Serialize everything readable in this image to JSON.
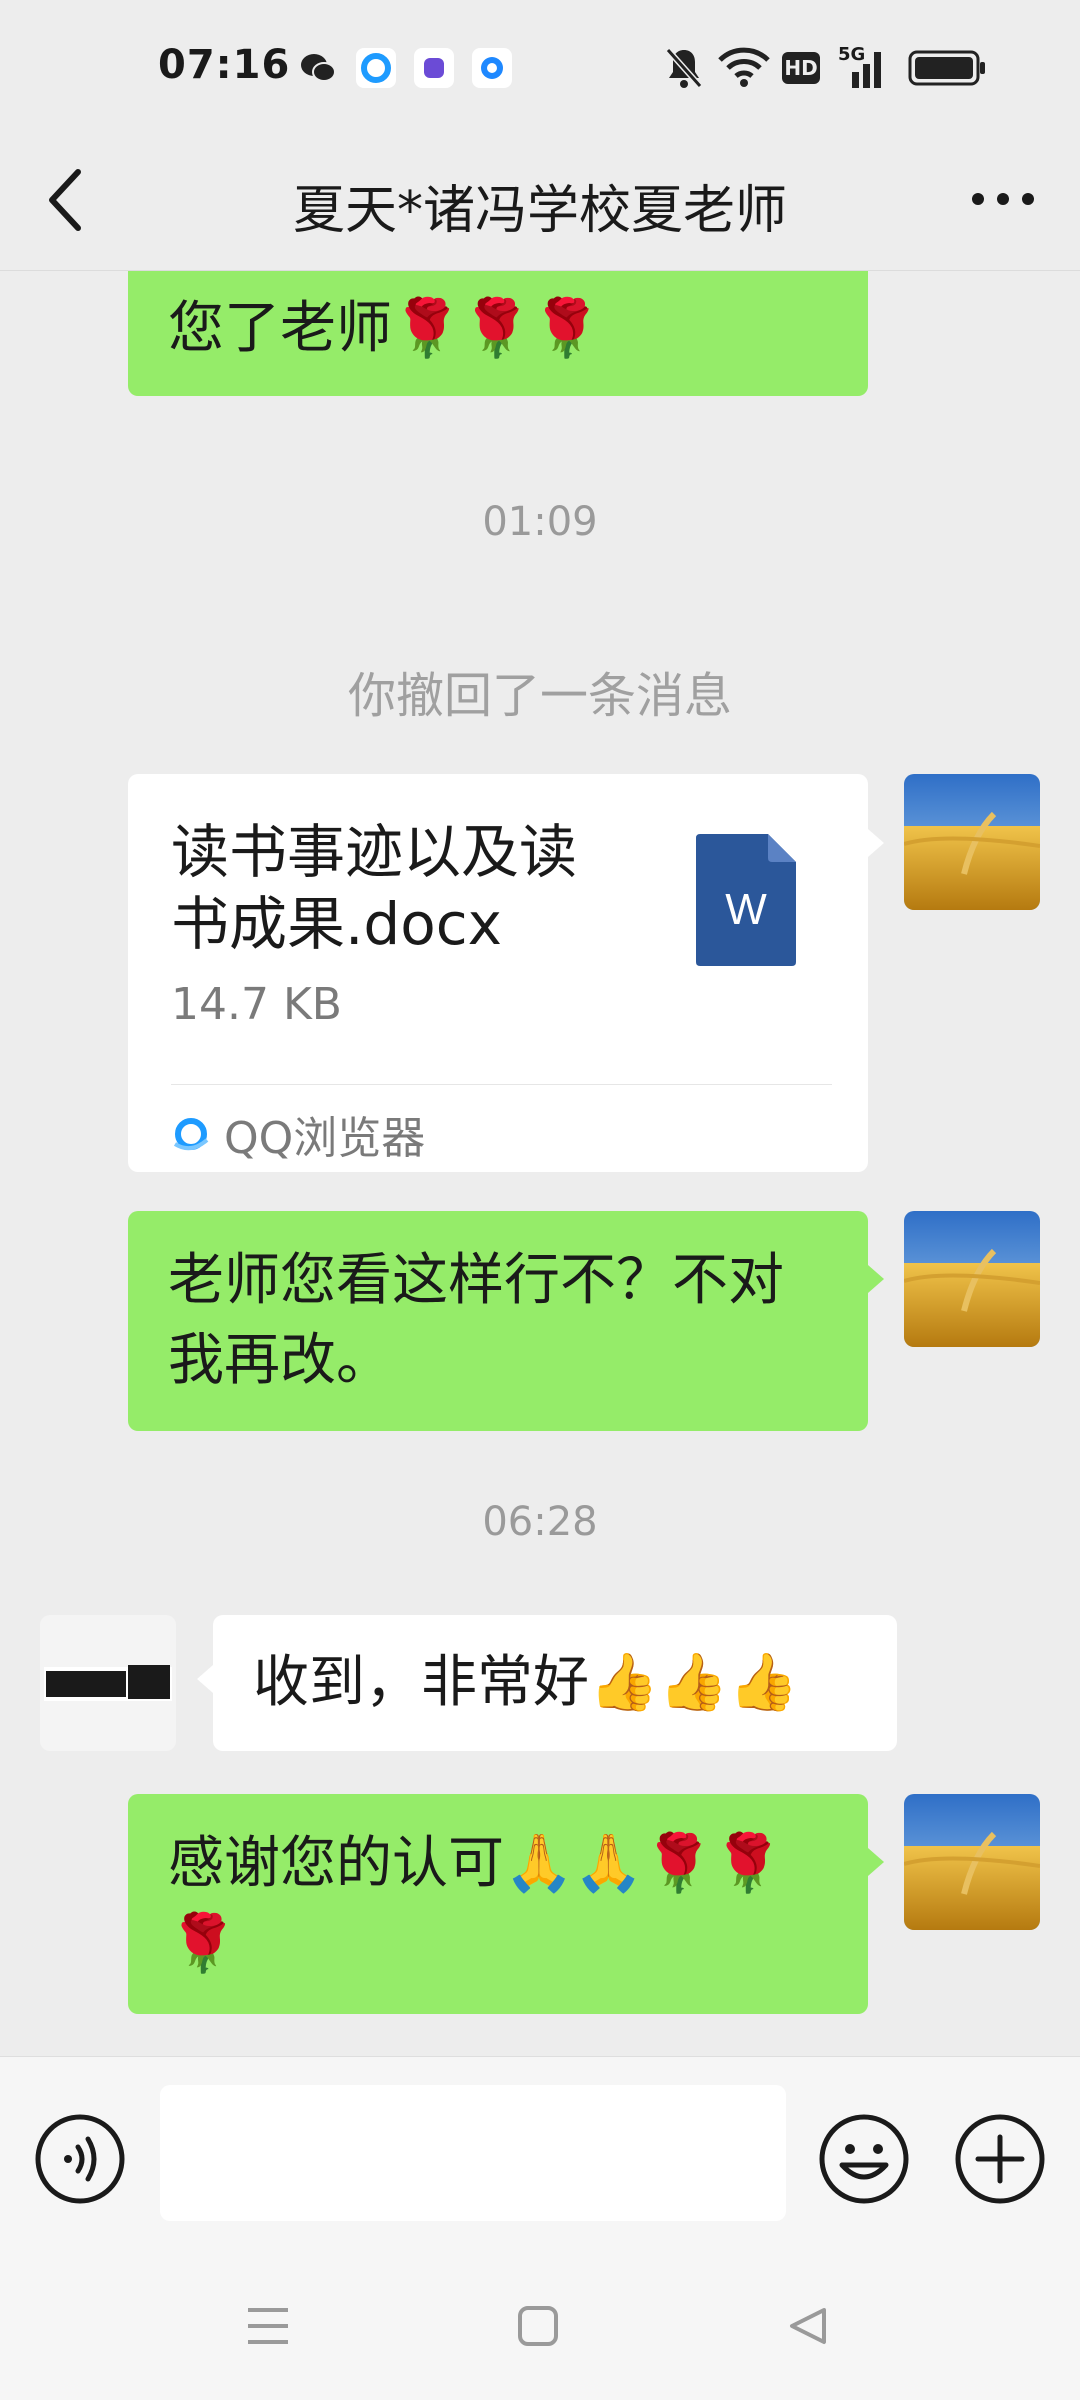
{
  "status_bar": {
    "time": "07:16",
    "notification_icons": [
      "wechat-icon",
      "qq-browser-icon",
      "purple-app-icon",
      "blue-ring-app-icon"
    ],
    "system_icons": [
      "mute-icon",
      "wifi-icon",
      "hd-icon",
      "signal-5g-icon",
      "battery-icon"
    ],
    "hd_label": "HD",
    "network_label": "5G"
  },
  "header": {
    "title": "夏天*诸冯学校夏老师",
    "back_icon": "back-arrow-icon",
    "more_icon": "more-dots-icon"
  },
  "messages": {
    "m0_text": "您了老师🌹🌹🌹",
    "time1": "01:09",
    "recall_notice": "你撤回了一条消息",
    "file": {
      "name": "读书事迹以及读书成果.docx",
      "size": "14.7 KB",
      "source": "QQ浏览器",
      "icon_letter": "W"
    },
    "m2_text": "老师您看这样行不？不对我再改。",
    "time2": "06:28",
    "m3_text": "收到，非常好👍👍👍",
    "m4_text": "感谢您的认可🙏🙏🌹🌹🌹"
  },
  "input_bar": {
    "voice_icon": "voice-icon",
    "emoji_icon": "emoji-icon",
    "plus_icon": "plus-icon",
    "input_value": ""
  },
  "nav_bar": {
    "icons": [
      "menu-icon",
      "home-icon",
      "back-icon"
    ]
  },
  "colors": {
    "sent_bubble": "#95ec69",
    "received_bubble": "#ffffff",
    "background": "#ededed",
    "word_blue": "#2b579a"
  }
}
